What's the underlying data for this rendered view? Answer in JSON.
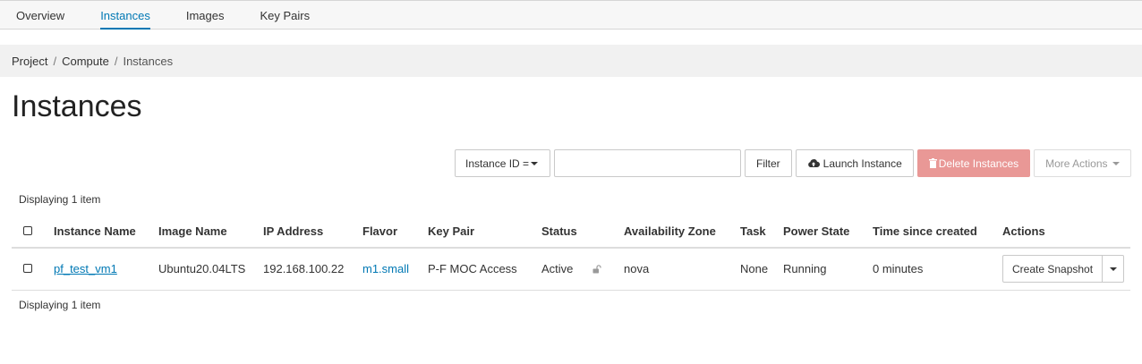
{
  "tabs": [
    {
      "label": "Overview"
    },
    {
      "label": "Instances"
    },
    {
      "label": "Images"
    },
    {
      "label": "Key Pairs"
    }
  ],
  "breadcrumb": [
    "Project",
    "Compute",
    "Instances"
  ],
  "page_title": "Instances",
  "toolbar": {
    "filter_select": "Instance ID =",
    "filter_value": "",
    "filter_button": "Filter",
    "launch_button": "Launch Instance",
    "delete_button": "Delete Instances",
    "more_actions": "More Actions"
  },
  "displaying_top": "Displaying 1 item",
  "displaying_bottom": "Displaying 1 item",
  "table": {
    "headers": [
      "Instance Name",
      "Image Name",
      "IP Address",
      "Flavor",
      "Key Pair",
      "Status",
      "Availability Zone",
      "Task",
      "Power State",
      "Time since created",
      "Actions"
    ],
    "rows": [
      {
        "instance_name": "pf_test_vm1",
        "image_name": "Ubuntu20.04LTS",
        "ip_address": "192.168.100.22",
        "flavor": "m1.small",
        "key_pair": "P-F MOC Access",
        "status": "Active",
        "availability_zone": "nova",
        "task": "None",
        "power_state": "Running",
        "time_since_created": "0 minutes",
        "action": "Create Snapshot"
      }
    ]
  },
  "colors": {
    "accent": "#0078b4",
    "danger_disabled": "#e99896"
  }
}
